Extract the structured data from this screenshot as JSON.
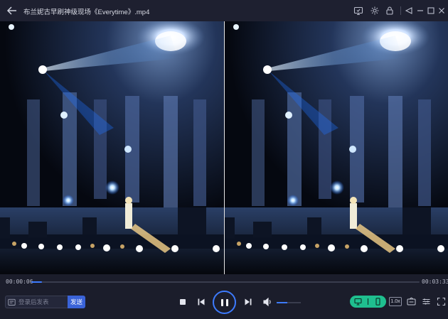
{
  "window": {
    "title": "布兰妮古早刷神级现场《Everytime》.mp4"
  },
  "titlebar_icons": [
    "screenshot-icon",
    "settings-icon",
    "lock-icon",
    "pin-icon",
    "minimize-icon",
    "maximize-icon",
    "close-icon"
  ],
  "playback": {
    "current_time": "00:00:06",
    "total_time": "00:03:33",
    "progress_fraction": 0.028
  },
  "danmaku": {
    "placeholder": "登录后发表",
    "send_label": "发送"
  },
  "controls": {
    "speed_label": "1.0x",
    "volume_fraction": 0.45,
    "state": "playing"
  },
  "colors": {
    "accent": "#3d7bff",
    "toggle": "#1fbf8f",
    "background": "#1b1d2b"
  }
}
